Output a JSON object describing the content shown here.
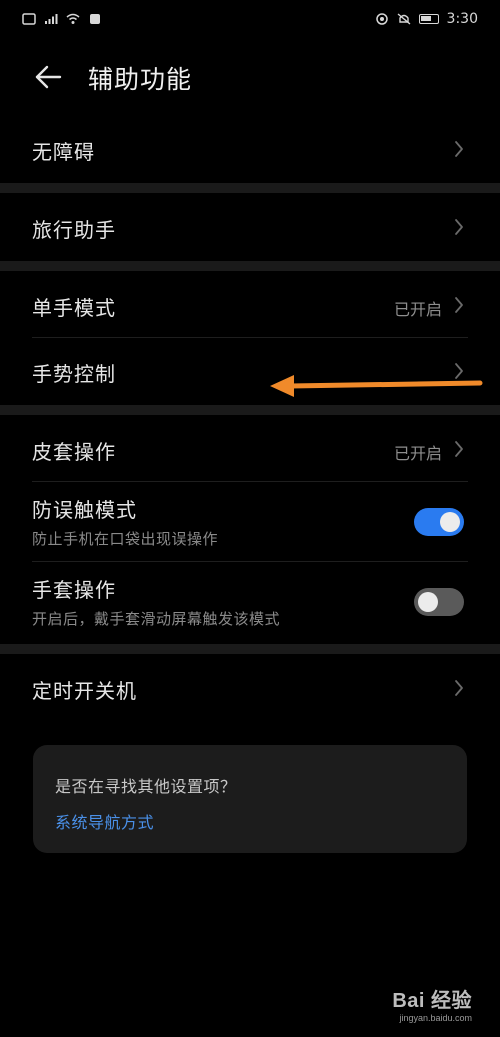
{
  "status_bar": {
    "left_icons": [
      "sim-icon",
      "signal-icon",
      "wifi-icon",
      "notification-icon"
    ],
    "right_icons": [
      "nfc-icon",
      "mute-icon",
      "battery-icon"
    ],
    "time": "3:30"
  },
  "header": {
    "title": "辅助功能",
    "back_icon": "arrow-left-icon"
  },
  "groups": [
    {
      "items": [
        {
          "label": "无障碍",
          "status": "",
          "control": "chevron"
        }
      ]
    },
    {
      "items": [
        {
          "label": "旅行助手",
          "status": "",
          "control": "chevron"
        }
      ]
    },
    {
      "items": [
        {
          "label": "单手模式",
          "status": "已开启",
          "control": "chevron"
        },
        {
          "label": "手势控制",
          "status": "",
          "control": "chevron"
        }
      ]
    },
    {
      "items": [
        {
          "label": "皮套操作",
          "status": "已开启",
          "control": "chevron"
        },
        {
          "label": "防误触模式",
          "sublabel": "防止手机在口袋出现误操作",
          "control": "toggle",
          "toggle_on": true
        },
        {
          "label": "手套操作",
          "sublabel": "开启后，戴手套滑动屏幕触发该模式",
          "control": "toggle",
          "toggle_on": false
        }
      ]
    },
    {
      "items": [
        {
          "label": "定时开关机",
          "status": "",
          "control": "chevron"
        }
      ]
    }
  ],
  "suggestion_card": {
    "question": "是否在寻找其他设置项？",
    "link": "系统导航方式"
  },
  "annotation": {
    "arrow_color": "#f08a2a",
    "target": "手势控制"
  },
  "watermark": {
    "brand": "Bai 经验",
    "url": "jingyan.baidu.com"
  },
  "colors": {
    "background": "#000000",
    "separator": "#1a1a1a",
    "accent": "#2a7bf0",
    "link": "#4a90e8"
  }
}
